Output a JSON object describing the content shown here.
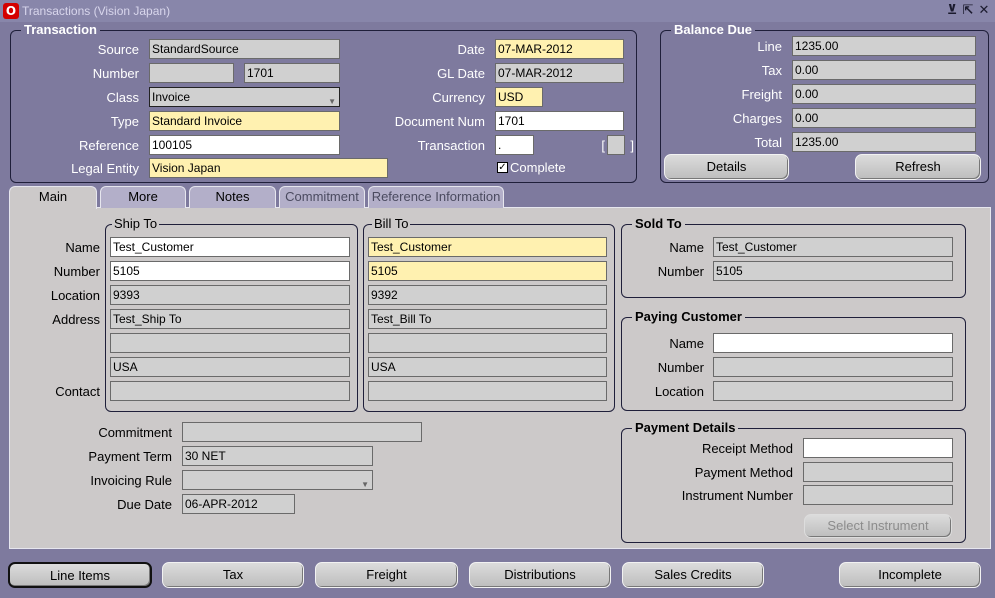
{
  "window": {
    "title": "Transactions (Vision Japan)",
    "controls": [
      "minimize-icon",
      "restore-icon",
      "close-icon"
    ]
  },
  "transaction": {
    "title": "Transaction",
    "source_label": "Source",
    "source": "StandardSource",
    "number_label": "Number",
    "number": "1701",
    "class_label": "Class",
    "class": "Invoice",
    "type_label": "Type",
    "type": "Standard Invoice",
    "reference_label": "Reference",
    "reference": "100105",
    "legal_entity_label": "Legal Entity",
    "legal_entity": "Vision Japan",
    "date_label": "Date",
    "date": "07-MAR-2012",
    "gl_date_label": "GL Date",
    "gl_date": "07-MAR-2012",
    "currency_label": "Currency",
    "currency": "USD",
    "document_num_label": "Document Num",
    "document_num": "1701",
    "transaction_label": "Transaction",
    "transaction_value": ".",
    "bracket_open": "[",
    "bracket_close": "]",
    "complete_label": "Complete",
    "complete_checked": true
  },
  "balance_due": {
    "title": "Balance Due",
    "line_label": "Line",
    "line": "1235.00",
    "tax_label": "Tax",
    "tax": "0.00",
    "freight_label": "Freight",
    "freight": "0.00",
    "charges_label": "Charges",
    "charges": "0.00",
    "total_label": "Total",
    "total": "1235.00",
    "details_button": "Details",
    "refresh_button": "Refresh"
  },
  "tabs": [
    "Main",
    "More",
    "Notes",
    "Commitment",
    "Reference Information"
  ],
  "ship_to": {
    "title": "Ship To",
    "name": "Test_Customer",
    "number": "5105",
    "location": "9393",
    "address": "Test_Ship To",
    "address2": "",
    "country": "USA",
    "contact": ""
  },
  "bill_to": {
    "title": "Bill To",
    "name": "Test_Customer",
    "number": "5105",
    "location": "9392",
    "address": "Test_Bill To",
    "address2": "",
    "country": "USA",
    "contact": ""
  },
  "row_labels": {
    "name": "Name",
    "number": "Number",
    "location": "Location",
    "address": "Address",
    "contact": "Contact"
  },
  "sold_to": {
    "title": "Sold To",
    "name_label": "Name",
    "name": "Test_Customer",
    "number_label": "Number",
    "number": "5105"
  },
  "paying_customer": {
    "title": "Paying Customer",
    "name_label": "Name",
    "name": "",
    "number_label": "Number",
    "number": "",
    "location_label": "Location",
    "location": ""
  },
  "terms": {
    "commitment_label": "Commitment",
    "commitment": "",
    "payment_term_label": "Payment Term",
    "payment_term": "30 NET",
    "invoicing_rule_label": "Invoicing Rule",
    "invoicing_rule": "",
    "due_date_label": "Due Date",
    "due_date": "06-APR-2012"
  },
  "payment_details": {
    "title": "Payment Details",
    "receipt_method_label": "Receipt Method",
    "receipt_method": "",
    "payment_method_label": "Payment Method",
    "payment_method": "",
    "instrument_number_label": "Instrument Number",
    "instrument_number": "",
    "select_instrument_button": "Select Instrument"
  },
  "bottom_buttons": {
    "line_items": "Line Items",
    "tax": "Tax",
    "freight": "Freight",
    "distributions": "Distributions",
    "sales_credits": "Sales Credits",
    "incomplete": "Incomplete"
  }
}
